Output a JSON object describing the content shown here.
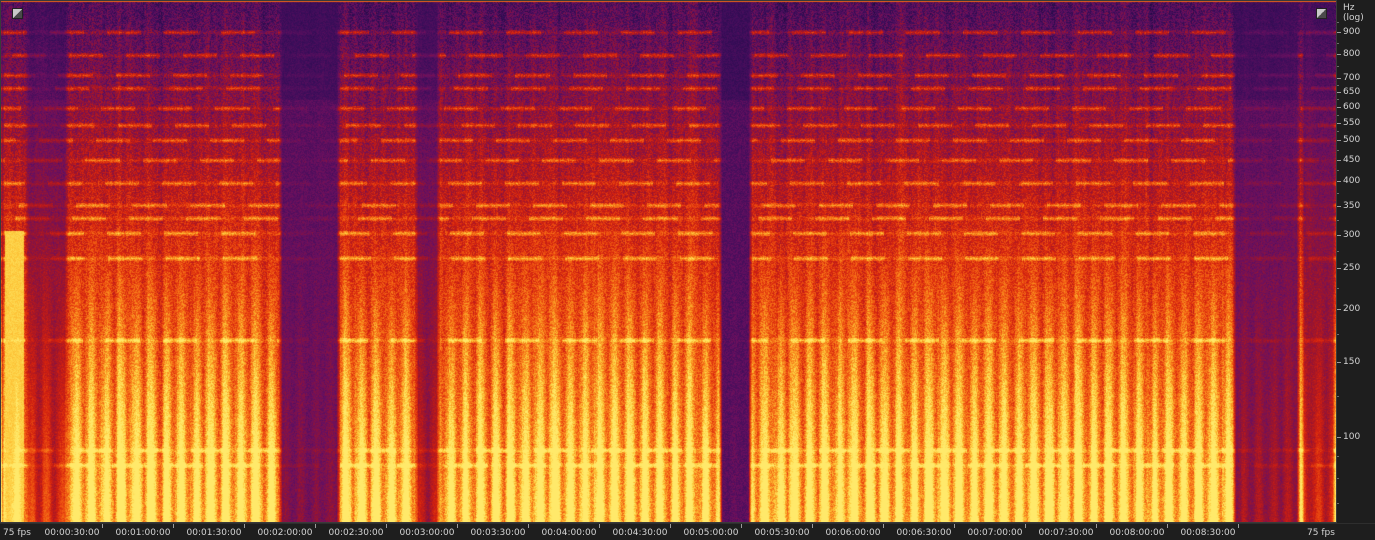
{
  "spectrogram": {
    "frequency_scale": "log",
    "palette": [
      "#1a0a3a",
      "#3a0d5a",
      "#6a1060",
      "#a0152a",
      "#d2200f",
      "#ee5010",
      "#f98a1e",
      "#fdc83a",
      "#ffe96a"
    ]
  },
  "frequency_axis": {
    "unit_label": "Hz (log)",
    "ticks": [
      {
        "value": 900,
        "label": "900"
      },
      {
        "value": 800,
        "label": "800"
      },
      {
        "value": 700,
        "label": "700"
      },
      {
        "value": 650,
        "label": "650"
      },
      {
        "value": 600,
        "label": "600"
      },
      {
        "value": 550,
        "label": "550"
      },
      {
        "value": 500,
        "label": "500"
      },
      {
        "value": 450,
        "label": "450"
      },
      {
        "value": 400,
        "label": "400"
      },
      {
        "value": 350,
        "label": "350"
      },
      {
        "value": 300,
        "label": "300"
      },
      {
        "value": 250,
        "label": "250"
      },
      {
        "value": 200,
        "label": "200"
      },
      {
        "value": 150,
        "label": "150"
      },
      {
        "value": 100,
        "label": "100"
      }
    ]
  },
  "time_axis": {
    "left_label": "75 fps",
    "right_label": "75 fps",
    "ticks": [
      "00:00:30:00",
      "00:01:00:00",
      "00:01:30:00",
      "00:02:00:00",
      "00:02:30:00",
      "00:03:00:00",
      "00:03:30:00",
      "00:04:00:00",
      "00:04:30:00",
      "00:05:00:00",
      "00:05:30:00",
      "00:06:00:00",
      "00:06:30:00",
      "00:07:00:00",
      "00:07:30:00",
      "00:08:00:00",
      "00:08:30:00"
    ]
  }
}
